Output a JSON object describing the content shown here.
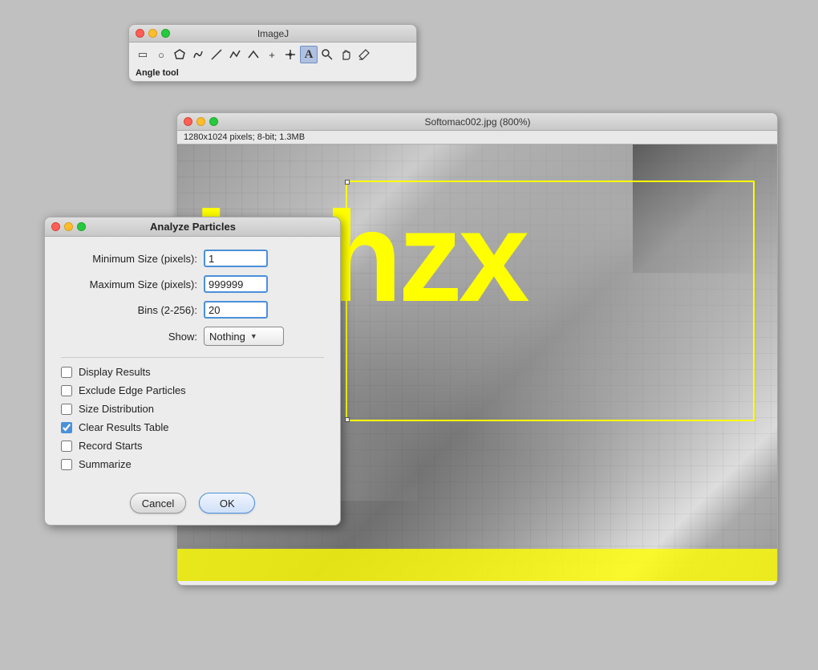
{
  "imagej_toolbar": {
    "title": "ImageJ",
    "status": "Angle tool",
    "tools": [
      {
        "name": "rectangle",
        "icon": "▭",
        "label": "rectangle-tool"
      },
      {
        "name": "oval",
        "icon": "○",
        "label": "oval-tool"
      },
      {
        "name": "polygon",
        "icon": "⬡",
        "label": "polygon-tool"
      },
      {
        "name": "freehand",
        "icon": "♡",
        "label": "freehand-tool"
      },
      {
        "name": "line",
        "icon": "╲",
        "label": "line-tool"
      },
      {
        "name": "segmented",
        "icon": "∿",
        "label": "segmented-tool"
      },
      {
        "name": "angle",
        "icon": "∧",
        "label": "angle-tool"
      },
      {
        "name": "crosshair",
        "icon": "+",
        "label": "crosshair-tool"
      },
      {
        "name": "point",
        "icon": "✱",
        "label": "point-tool"
      },
      {
        "name": "text",
        "icon": "A",
        "label": "text-tool"
      },
      {
        "name": "magnifier",
        "icon": "⌕",
        "label": "magnifier-tool"
      },
      {
        "name": "hand",
        "icon": "✋",
        "label": "hand-tool"
      },
      {
        "name": "eyedropper",
        "icon": "✏",
        "label": "eyedropper-tool"
      }
    ]
  },
  "image_window": {
    "title": "Softomac002.jpg (800%)",
    "info": "1280x1024 pixels; 8-bit; 1.3MB",
    "yellow_text": "j  chzx"
  },
  "dialog": {
    "title": "Analyze Particles",
    "fields": {
      "min_size_label": "Minimum Size (pixels):",
      "min_size_value": "1",
      "max_size_label": "Maximum Size (pixels):",
      "max_size_value": "999999",
      "bins_label": "Bins (2-256):",
      "bins_value": "20",
      "show_label": "Show:",
      "show_value": "Nothing"
    },
    "checkboxes": [
      {
        "id": "display-results",
        "label": "Display Results",
        "checked": false
      },
      {
        "id": "exclude-edge",
        "label": "Exclude Edge Particles",
        "checked": false
      },
      {
        "id": "size-dist",
        "label": "Size Distribution",
        "checked": false
      },
      {
        "id": "clear-results",
        "label": "Clear Results Table",
        "checked": true
      },
      {
        "id": "record-starts",
        "label": "Record Starts",
        "checked": false
      },
      {
        "id": "summarize",
        "label": "Summarize",
        "checked": false
      }
    ],
    "buttons": {
      "cancel": "Cancel",
      "ok": "OK"
    }
  }
}
